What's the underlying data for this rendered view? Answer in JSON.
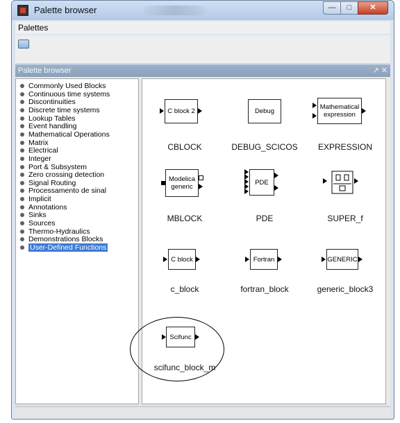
{
  "window": {
    "title": "Palette browser",
    "controls": {
      "minimize": "—",
      "maximize": "□",
      "close": "✕"
    }
  },
  "menubar": {
    "label": "Palettes"
  },
  "toolbar": {
    "icon": "folder-icon"
  },
  "panel": {
    "title": "Palette browser",
    "controls": "↗ ✕"
  },
  "tree": {
    "selected_index": 20,
    "items": [
      "Commonly Used Blocks",
      "Continuous time systems",
      "Discontinuities",
      "Discrete time systems",
      "Lookup Tables",
      "Event handling",
      "Mathematical Operations",
      "Matrix",
      "Electrical",
      "Integer",
      "Port & Subsystem",
      "Zero crossing detection",
      "Signal Routing",
      "Processamento de sinal",
      "Implicit",
      "Annotations",
      "Sinks",
      "Sources",
      "Thermo-Hydraulics",
      "Demonstrations Blocks",
      "User-Defined Functions"
    ]
  },
  "blocks": [
    {
      "name": "CBLOCK",
      "label": "C block 2"
    },
    {
      "name": "DEBUG_SCICOS",
      "label": "Debug"
    },
    {
      "name": "EXPRESSION",
      "label": "Mathematical expression"
    },
    {
      "name": "MBLOCK",
      "label": "Modelica generic"
    },
    {
      "name": "PDE",
      "label": "PDE"
    },
    {
      "name": "SUPER_f",
      "label": ""
    },
    {
      "name": "c_block",
      "label": "C block"
    },
    {
      "name": "fortran_block",
      "label": "Fortran"
    },
    {
      "name": "generic_block3",
      "label": "GENERIC"
    },
    {
      "name": "scifunc_block_m",
      "label": "Scifunc"
    }
  ]
}
